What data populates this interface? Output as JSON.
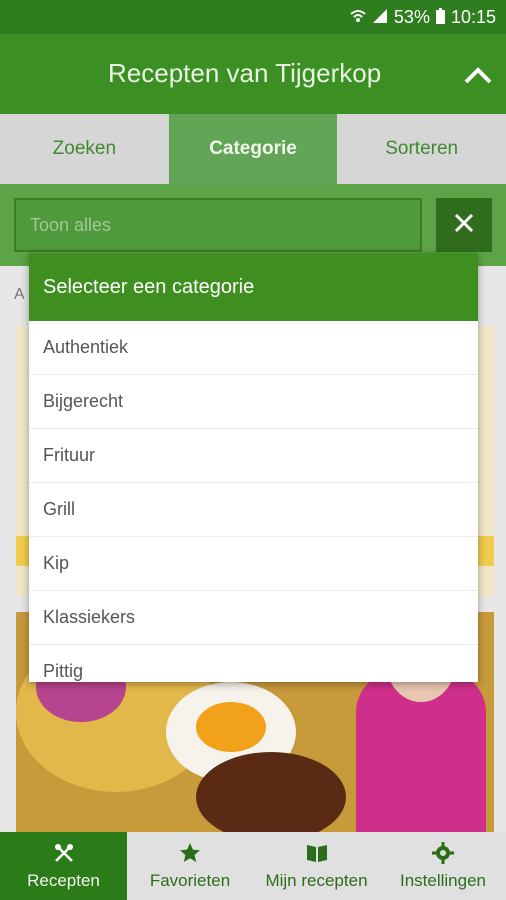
{
  "status_bar": {
    "battery": "53%",
    "time": "10:15"
  },
  "app_bar": {
    "title": "Recepten van Tijgerkop"
  },
  "tabs": [
    {
      "label": "Zoeken"
    },
    {
      "label": "Categorie"
    },
    {
      "label": "Sorteren"
    }
  ],
  "filter": {
    "value": "Toon alles"
  },
  "content": {
    "letter": "A"
  },
  "dropdown": {
    "title": "Selecteer een categorie",
    "items": [
      "Authentiek",
      "Bijgerecht",
      "Frituur",
      "Grill",
      "Kip",
      "Klassiekers",
      "Pittig"
    ]
  },
  "bottom_nav": [
    {
      "label": "Recepten",
      "icon": "cutlery-icon"
    },
    {
      "label": "Favorieten",
      "icon": "star-icon"
    },
    {
      "label": "Mijn recepten",
      "icon": "book-icon"
    },
    {
      "label": "Instellingen",
      "icon": "gear-icon"
    }
  ]
}
